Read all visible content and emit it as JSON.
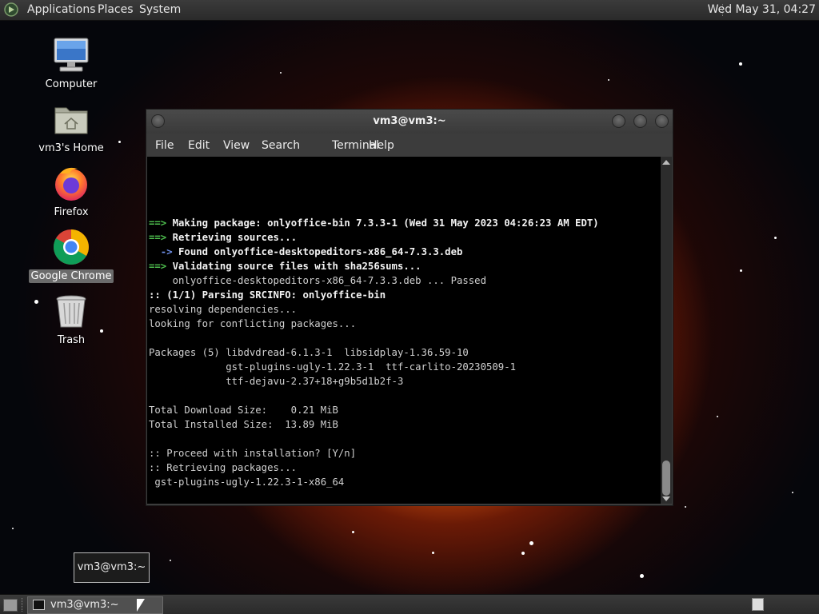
{
  "top_panel": {
    "menus": [
      "Applications",
      "Places",
      "System"
    ],
    "clock": "Wed May 31, 04:27"
  },
  "desktop_icons": [
    {
      "label": "Computer",
      "icon": "computer-icon"
    },
    {
      "label": "vm3's Home",
      "icon": "home-folder-icon"
    },
    {
      "label": "Firefox",
      "icon": "firefox-icon"
    },
    {
      "label": "Google Chrome",
      "icon": "chrome-icon",
      "selected": true
    },
    {
      "label": "Trash",
      "icon": "trash-icon"
    }
  ],
  "terminal": {
    "title": "vm3@vm3:~",
    "menu": [
      "File",
      "Edit",
      "View",
      "Search",
      "Terminal",
      "Help"
    ],
    "lines": [
      {
        "arrow": "==>",
        "text": "Making package: onlyoffice-bin 7.3.3-1 (Wed 31 May 2023 04:26:23 AM EDT)"
      },
      {
        "arrow": "==>",
        "text": "Retrieving sources..."
      },
      {
        "arrow": "  ->",
        "text": "Found onlyoffice-desktopeditors-x86_64-7.3.3.deb"
      },
      {
        "arrow": "==>",
        "text": "Validating source files with sha256sums..."
      },
      {
        "plain": "    onlyoffice-desktopeditors-x86_64-7.3.3.deb ... Passed"
      },
      {
        "prefix": ":: (1/1) Parsing SRCINFO: ",
        "text": "onlyoffice-bin"
      },
      {
        "plain": "resolving dependencies..."
      },
      {
        "plain": "looking for conflicting packages..."
      },
      {
        "plain": ""
      },
      {
        "plain": "Packages (5) libdvdread-6.1.3-1  libsidplay-1.36.59-10"
      },
      {
        "plain": "             gst-plugins-ugly-1.22.3-1  ttf-carlito-20230509-1"
      },
      {
        "plain": "             ttf-dejavu-2.37+18+g9b5d1b2f-3"
      },
      {
        "plain": ""
      },
      {
        "plain": "Total Download Size:    0.21 MiB"
      },
      {
        "plain": "Total Installed Size:  13.89 MiB"
      },
      {
        "plain": ""
      },
      {
        "plain": ":: Proceed with installation? [Y/n]"
      },
      {
        "plain": ":: Retrieving packages..."
      },
      {
        "plain": " gst-plugins-ugly-1.22.3-1-x86_64"
      }
    ]
  },
  "tooltip": "vm3@vm3:~",
  "taskbar": {
    "window_button": "vm3@vm3:~"
  }
}
